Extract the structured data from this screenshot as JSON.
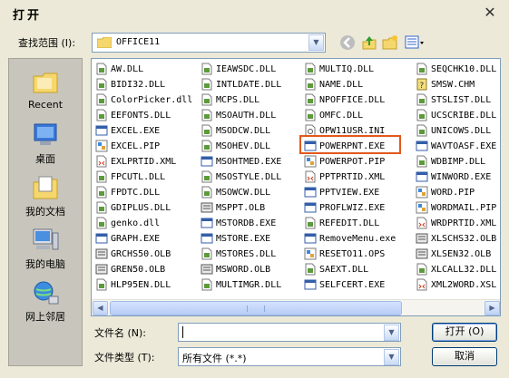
{
  "window": {
    "title": "打开"
  },
  "lookin": {
    "label": "查找范围 (I):",
    "value": "OFFICE11"
  },
  "places": [
    {
      "label": "Recent",
      "icon": "recent-folder-icon"
    },
    {
      "label": "桌面",
      "icon": "desktop-icon"
    },
    {
      "label": "我的文档",
      "icon": "my-documents-icon"
    },
    {
      "label": "我的电脑",
      "icon": "my-computer-icon"
    },
    {
      "label": "网上邻居",
      "icon": "network-icon"
    }
  ],
  "files": {
    "col1": [
      "AW.DLL",
      "BIDI32.DLL",
      "ColorPicker.dll",
      "EEFONTS.DLL",
      "EXCEL.EXE",
      "EXCEL.PIP",
      "EXLPRTID.XML",
      "FPCUTL.DLL",
      "FPDTC.DLL",
      "GDIPLUS.DLL",
      "genko.dll",
      "GRAPH.EXE",
      "GRCHS50.OLB",
      "GREN50.OLB",
      "HLP95EN.DLL"
    ],
    "col2": [
      "IEAWSDC.DLL",
      "INTLDATE.DLL",
      "MCPS.DLL",
      "MSOAUTH.DLL",
      "MSODCW.DLL",
      "MSOHEV.DLL",
      "MSOHTMED.EXE",
      "MSOSTYLE.DLL",
      "MSOWCW.DLL",
      "MSPPT.OLB",
      "MSTORDB.EXE",
      "MSTORE.EXE",
      "MSTORES.DLL",
      "MSWORD.OLB",
      "MULTIMGR.DLL"
    ],
    "col3": [
      "MULTIQ.DLL",
      "NAME.DLL",
      "NPOFFICE.DLL",
      "OMFC.DLL",
      "OPW11USR.INI",
      "POWERPNT.EXE",
      "POWERPOT.PIP",
      "PPTPRTID.XML",
      "PPTVIEW.EXE",
      "PROFLWIZ.EXE",
      "REFEDIT.DLL",
      "RemoveMenu.exe",
      "RESETO11.OPS",
      "SAEXT.DLL",
      "SELFCERT.EXE"
    ],
    "col4": [
      "SEQCHK10.DLL",
      "SMSW.CHM",
      "STSLIST.DLL",
      "UCSCRIBE.DLL",
      "UNICOWS.DLL",
      "WAVTOASF.EXE",
      "WDBIMP.DLL",
      "WINWORD.EXE",
      "WORD.PIP",
      "WORDMAIL.PIP",
      "WRDPRTID.XML",
      "XLSCHS32.OLB",
      "XLSEN32.OLB",
      "XLCALL32.DLL",
      "XML2WORD.XSL"
    ]
  },
  "filename": {
    "label": "文件名 (N):",
    "value": ""
  },
  "filetype": {
    "label": "文件类型 (T):",
    "value": "所有文件 (*.*)"
  },
  "buttons": {
    "open": "打开 (O)",
    "cancel": "取消"
  }
}
